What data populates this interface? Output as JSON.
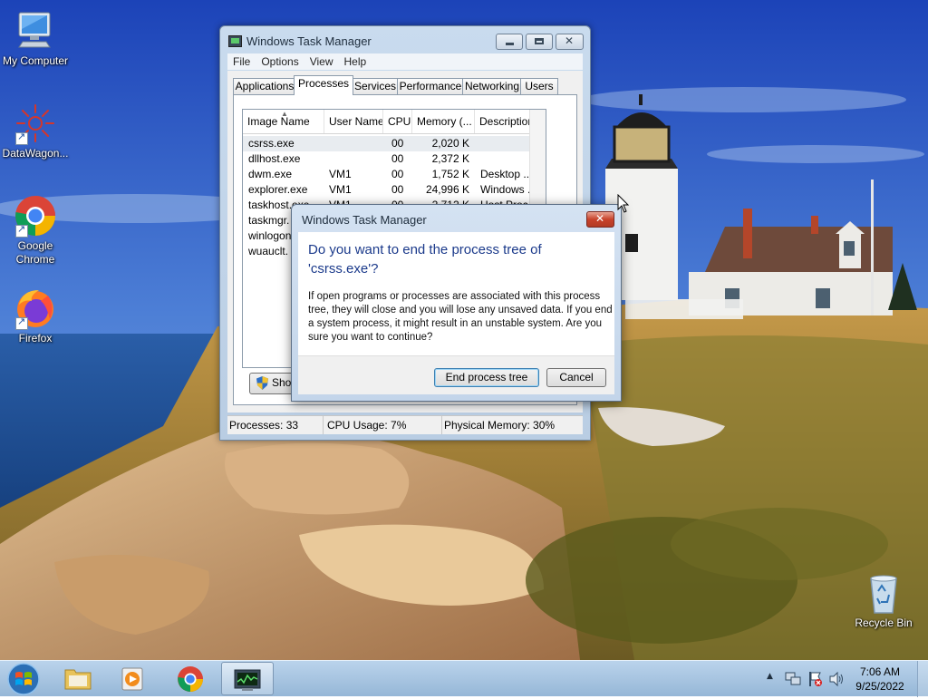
{
  "desktop": {
    "icons": [
      {
        "label": "My Computer"
      },
      {
        "label": "DataWagon..."
      },
      {
        "label": "Google Chrome"
      },
      {
        "label": "Firefox"
      },
      {
        "label": "Recycle Bin"
      }
    ]
  },
  "task_manager": {
    "title": "Windows Task Manager",
    "menu": [
      "File",
      "Options",
      "View",
      "Help"
    ],
    "tabs": [
      "Applications",
      "Processes",
      "Services",
      "Performance",
      "Networking",
      "Users"
    ],
    "active_tab": "Processes",
    "columns": [
      "Image Name",
      "User Name",
      "CPU",
      "Memory (...",
      "Description"
    ],
    "rows": [
      {
        "image": "csrss.exe",
        "user": "",
        "cpu": "00",
        "mem": "2,020 K",
        "desc": ""
      },
      {
        "image": "dllhost.exe",
        "user": "",
        "cpu": "00",
        "mem": "2,372 K",
        "desc": ""
      },
      {
        "image": "dwm.exe",
        "user": "VM1",
        "cpu": "00",
        "mem": "1,752 K",
        "desc": "Desktop ..."
      },
      {
        "image": "explorer.exe",
        "user": "VM1",
        "cpu": "00",
        "mem": "24,996 K",
        "desc": "Windows ..."
      },
      {
        "image": "taskhost.exe",
        "user": "VM1",
        "cpu": "00",
        "mem": "2,712 K",
        "desc": "Host Proc..."
      },
      {
        "image": "taskmgr.",
        "user": "",
        "cpu": "",
        "mem": "",
        "desc": ""
      },
      {
        "image": "winlogon",
        "user": "",
        "cpu": "",
        "mem": "",
        "desc": ""
      },
      {
        "image": "wuauclt.",
        "user": "",
        "cpu": "",
        "mem": "",
        "desc": ""
      }
    ],
    "show_button": "Show",
    "status": {
      "processes": "Processes: 33",
      "cpu": "CPU Usage: 7%",
      "memory": "Physical Memory: 30%"
    }
  },
  "dialog": {
    "title": "Windows Task Manager",
    "heading": "Do you want to end the process tree of 'csrss.exe'?",
    "body": "If open programs or processes are associated with this process tree, they will close and you will lose any unsaved data. If you end a system process, it might result in an unstable system. Are you sure you want to continue?",
    "confirm_label": "End process tree",
    "cancel_label": "Cancel"
  },
  "taskbar": {
    "time": "7:06 AM",
    "date": "9/25/2022"
  }
}
